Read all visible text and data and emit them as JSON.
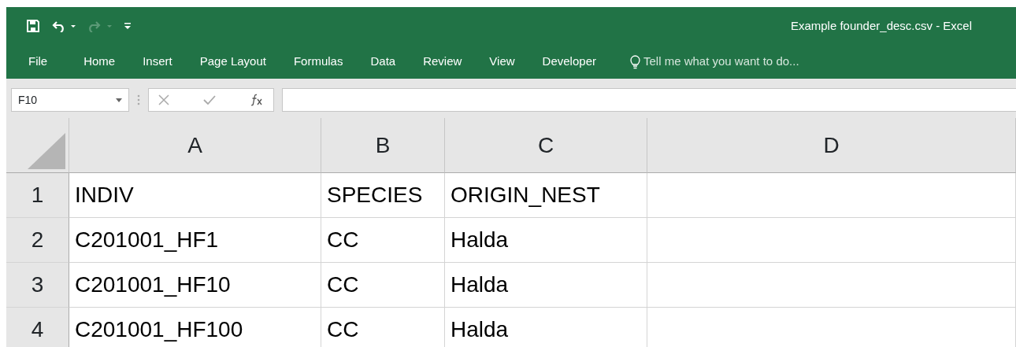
{
  "window": {
    "title": "Example founder_desc.csv - Excel"
  },
  "ribbon_tabs": [
    {
      "label": "File",
      "kind": "file"
    },
    {
      "label": "Home",
      "kind": "tab"
    },
    {
      "label": "Insert",
      "kind": "tab"
    },
    {
      "label": "Page Layout",
      "kind": "tab"
    },
    {
      "label": "Formulas",
      "kind": "tab"
    },
    {
      "label": "Data",
      "kind": "tab"
    },
    {
      "label": "Review",
      "kind": "tab"
    },
    {
      "label": "View",
      "kind": "tab"
    },
    {
      "label": "Developer",
      "kind": "tab"
    }
  ],
  "tell_me": {
    "placeholder": "Tell me what you want to do..."
  },
  "formula_bar": {
    "name_box": "F10"
  },
  "sheet": {
    "columns": [
      "A",
      "B",
      "C",
      "D"
    ],
    "rows": [
      {
        "number": "1",
        "cells": [
          "INDIV",
          "SPECIES",
          "ORIGIN_NEST"
        ]
      },
      {
        "number": "2",
        "cells": [
          "C201001_HF1",
          "CC",
          "Halda"
        ]
      },
      {
        "number": "3",
        "cells": [
          "C201001_HF10",
          "CC",
          "Halda"
        ]
      },
      {
        "number": "4",
        "cells": [
          "C201001_HF100",
          "CC",
          "Halda"
        ]
      }
    ]
  }
}
